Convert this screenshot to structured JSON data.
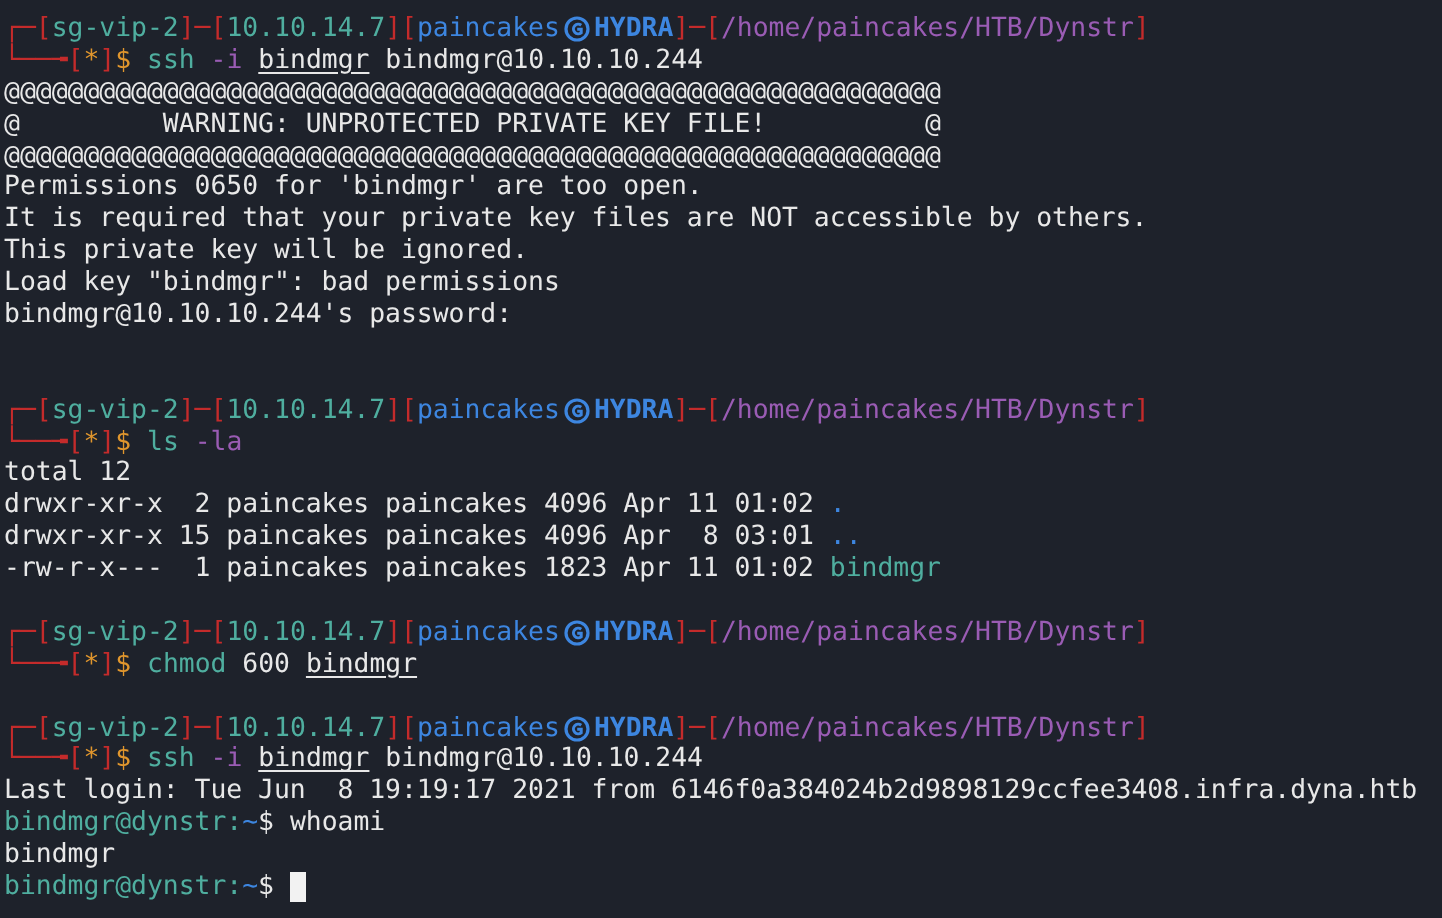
{
  "terminal": {
    "lines": [
      {
        "kind": "prompt",
        "segments": [
          {
            "kind": "frame",
            "text": "┌─["
          },
          {
            "kind": "vpn",
            "text": "sg-vip-2"
          },
          {
            "kind": "frame",
            "text": "]─["
          },
          {
            "kind": "ip",
            "text": "10.10.14.7"
          },
          {
            "kind": "frame",
            "text": "]["
          },
          {
            "kind": "user",
            "text": "paincakes"
          },
          {
            "kind": "host",
            "text": "HYDRA"
          },
          {
            "kind": "frame",
            "text": "]─["
          },
          {
            "kind": "path",
            "text": "/home/paincakes/HTB/Dynstr"
          },
          {
            "kind": "frame",
            "text": "]"
          }
        ]
      },
      {
        "kind": "command",
        "segments": [
          {
            "kind": "frame",
            "text": "└──╼["
          },
          {
            "kind": "star",
            "text": "*"
          },
          {
            "kind": "frame",
            "text": "]"
          },
          {
            "kind": "sigil",
            "text": "$"
          }
        ],
        "tokens": [
          {
            "kind": "program",
            "text": "ssh",
            "underlined": false
          },
          {
            "kind": "flag",
            "text": "-i",
            "underlined": false
          },
          {
            "kind": "arg",
            "text": "bindmgr",
            "underlined": true
          },
          {
            "kind": "arg",
            "text": "bindmgr@10.10.10.244",
            "underlined": false
          }
        ]
      },
      {
        "kind": "output",
        "text": "@@@@@@@@@@@@@@@@@@@@@@@@@@@@@@@@@@@@@@@@@@@@@@@@@@@@@@@@@@@"
      },
      {
        "kind": "output",
        "text": "@         WARNING: UNPROTECTED PRIVATE KEY FILE!          @"
      },
      {
        "kind": "output",
        "text": "@@@@@@@@@@@@@@@@@@@@@@@@@@@@@@@@@@@@@@@@@@@@@@@@@@@@@@@@@@@"
      },
      {
        "kind": "output",
        "text": "Permissions 0650 for 'bindmgr' are too open."
      },
      {
        "kind": "output",
        "text": "It is required that your private key files are NOT accessible by others."
      },
      {
        "kind": "output",
        "text": "This private key will be ignored."
      },
      {
        "kind": "output",
        "text": "Load key \"bindmgr\": bad permissions"
      },
      {
        "kind": "output",
        "text": "bindmgr@10.10.10.244's password:"
      },
      {
        "kind": "blank"
      },
      {
        "kind": "blank"
      },
      {
        "kind": "prompt",
        "segments": [
          {
            "kind": "frame",
            "text": "┌─["
          },
          {
            "kind": "vpn",
            "text": "sg-vip-2"
          },
          {
            "kind": "frame",
            "text": "]─["
          },
          {
            "kind": "ip",
            "text": "10.10.14.7"
          },
          {
            "kind": "frame",
            "text": "]["
          },
          {
            "kind": "user",
            "text": "paincakes"
          },
          {
            "kind": "host",
            "text": "HYDRA"
          },
          {
            "kind": "frame",
            "text": "]─["
          },
          {
            "kind": "path",
            "text": "/home/paincakes/HTB/Dynstr"
          },
          {
            "kind": "frame",
            "text": "]"
          }
        ]
      },
      {
        "kind": "command",
        "segments": [
          {
            "kind": "frame",
            "text": "└──╼["
          },
          {
            "kind": "star",
            "text": "*"
          },
          {
            "kind": "frame",
            "text": "]"
          },
          {
            "kind": "sigil",
            "text": "$"
          }
        ],
        "tokens": [
          {
            "kind": "program",
            "text": "ls",
            "underlined": false
          },
          {
            "kind": "flag",
            "text": "-la",
            "underlined": false
          }
        ]
      },
      {
        "kind": "output",
        "text": "total 12"
      },
      {
        "kind": "listing",
        "text": "drwxr-xr-x  2 paincakes paincakes 4096 Apr 11 01:02",
        "entry": {
          "kind": "dir",
          "text": "."
        }
      },
      {
        "kind": "listing",
        "text": "drwxr-xr-x 15 paincakes paincakes 4096 Apr  8 03:01",
        "entry": {
          "kind": "dir",
          "text": ".."
        }
      },
      {
        "kind": "listing",
        "text": "-rw-r-x---  1 paincakes paincakes 1823 Apr 11 01:02",
        "entry": {
          "kind": "file",
          "text": "bindmgr"
        }
      },
      {
        "kind": "blank"
      },
      {
        "kind": "prompt",
        "segments": [
          {
            "kind": "frame",
            "text": "┌─["
          },
          {
            "kind": "vpn",
            "text": "sg-vip-2"
          },
          {
            "kind": "frame",
            "text": "]─["
          },
          {
            "kind": "ip",
            "text": "10.10.14.7"
          },
          {
            "kind": "frame",
            "text": "]["
          },
          {
            "kind": "user",
            "text": "paincakes"
          },
          {
            "kind": "host",
            "text": "HYDRA"
          },
          {
            "kind": "frame",
            "text": "]─["
          },
          {
            "kind": "path",
            "text": "/home/paincakes/HTB/Dynstr"
          },
          {
            "kind": "frame",
            "text": "]"
          }
        ]
      },
      {
        "kind": "command",
        "segments": [
          {
            "kind": "frame",
            "text": "└──╼["
          },
          {
            "kind": "star",
            "text": "*"
          },
          {
            "kind": "frame",
            "text": "]"
          },
          {
            "kind": "sigil",
            "text": "$"
          }
        ],
        "tokens": [
          {
            "kind": "program",
            "text": "chmod",
            "underlined": false
          },
          {
            "kind": "arg",
            "text": "600",
            "underlined": false
          },
          {
            "kind": "arg",
            "text": "bindmgr",
            "underlined": true
          }
        ]
      },
      {
        "kind": "blank"
      },
      {
        "kind": "prompt",
        "segments": [
          {
            "kind": "frame",
            "text": "┌─["
          },
          {
            "kind": "vpn",
            "text": "sg-vip-2"
          },
          {
            "kind": "frame",
            "text": "]─["
          },
          {
            "kind": "ip",
            "text": "10.10.14.7"
          },
          {
            "kind": "frame",
            "text": "]["
          },
          {
            "kind": "user",
            "text": "paincakes"
          },
          {
            "kind": "host",
            "text": "HYDRA"
          },
          {
            "kind": "frame",
            "text": "]─["
          },
          {
            "kind": "path",
            "text": "/home/paincakes/HTB/Dynstr"
          },
          {
            "kind": "frame",
            "text": "]"
          }
        ]
      },
      {
        "kind": "command",
        "segments": [
          {
            "kind": "frame",
            "text": "└──╼["
          },
          {
            "kind": "star",
            "text": "*"
          },
          {
            "kind": "frame",
            "text": "]"
          },
          {
            "kind": "sigil",
            "text": "$"
          }
        ],
        "tokens": [
          {
            "kind": "program",
            "text": "ssh",
            "underlined": false
          },
          {
            "kind": "flag",
            "text": "-i",
            "underlined": false
          },
          {
            "kind": "arg",
            "text": "bindmgr",
            "underlined": true
          },
          {
            "kind": "arg",
            "text": "bindmgr@10.10.10.244",
            "underlined": false
          }
        ]
      },
      {
        "kind": "output",
        "text": "Last login: Tue Jun  8 19:19:17 2021 from 6146f0a384024b2d9898129ccfee3408.infra.dyna.htb"
      },
      {
        "kind": "remote",
        "userhost": "bindmgr@dynstr:",
        "cwd": "~",
        "sigil": "$",
        "command": "whoami"
      },
      {
        "kind": "output",
        "text": "bindmgr"
      },
      {
        "kind": "remote",
        "userhost": "bindmgr@dynstr:",
        "cwd": "~",
        "sigil": "$",
        "cursor": true
      }
    ]
  }
}
